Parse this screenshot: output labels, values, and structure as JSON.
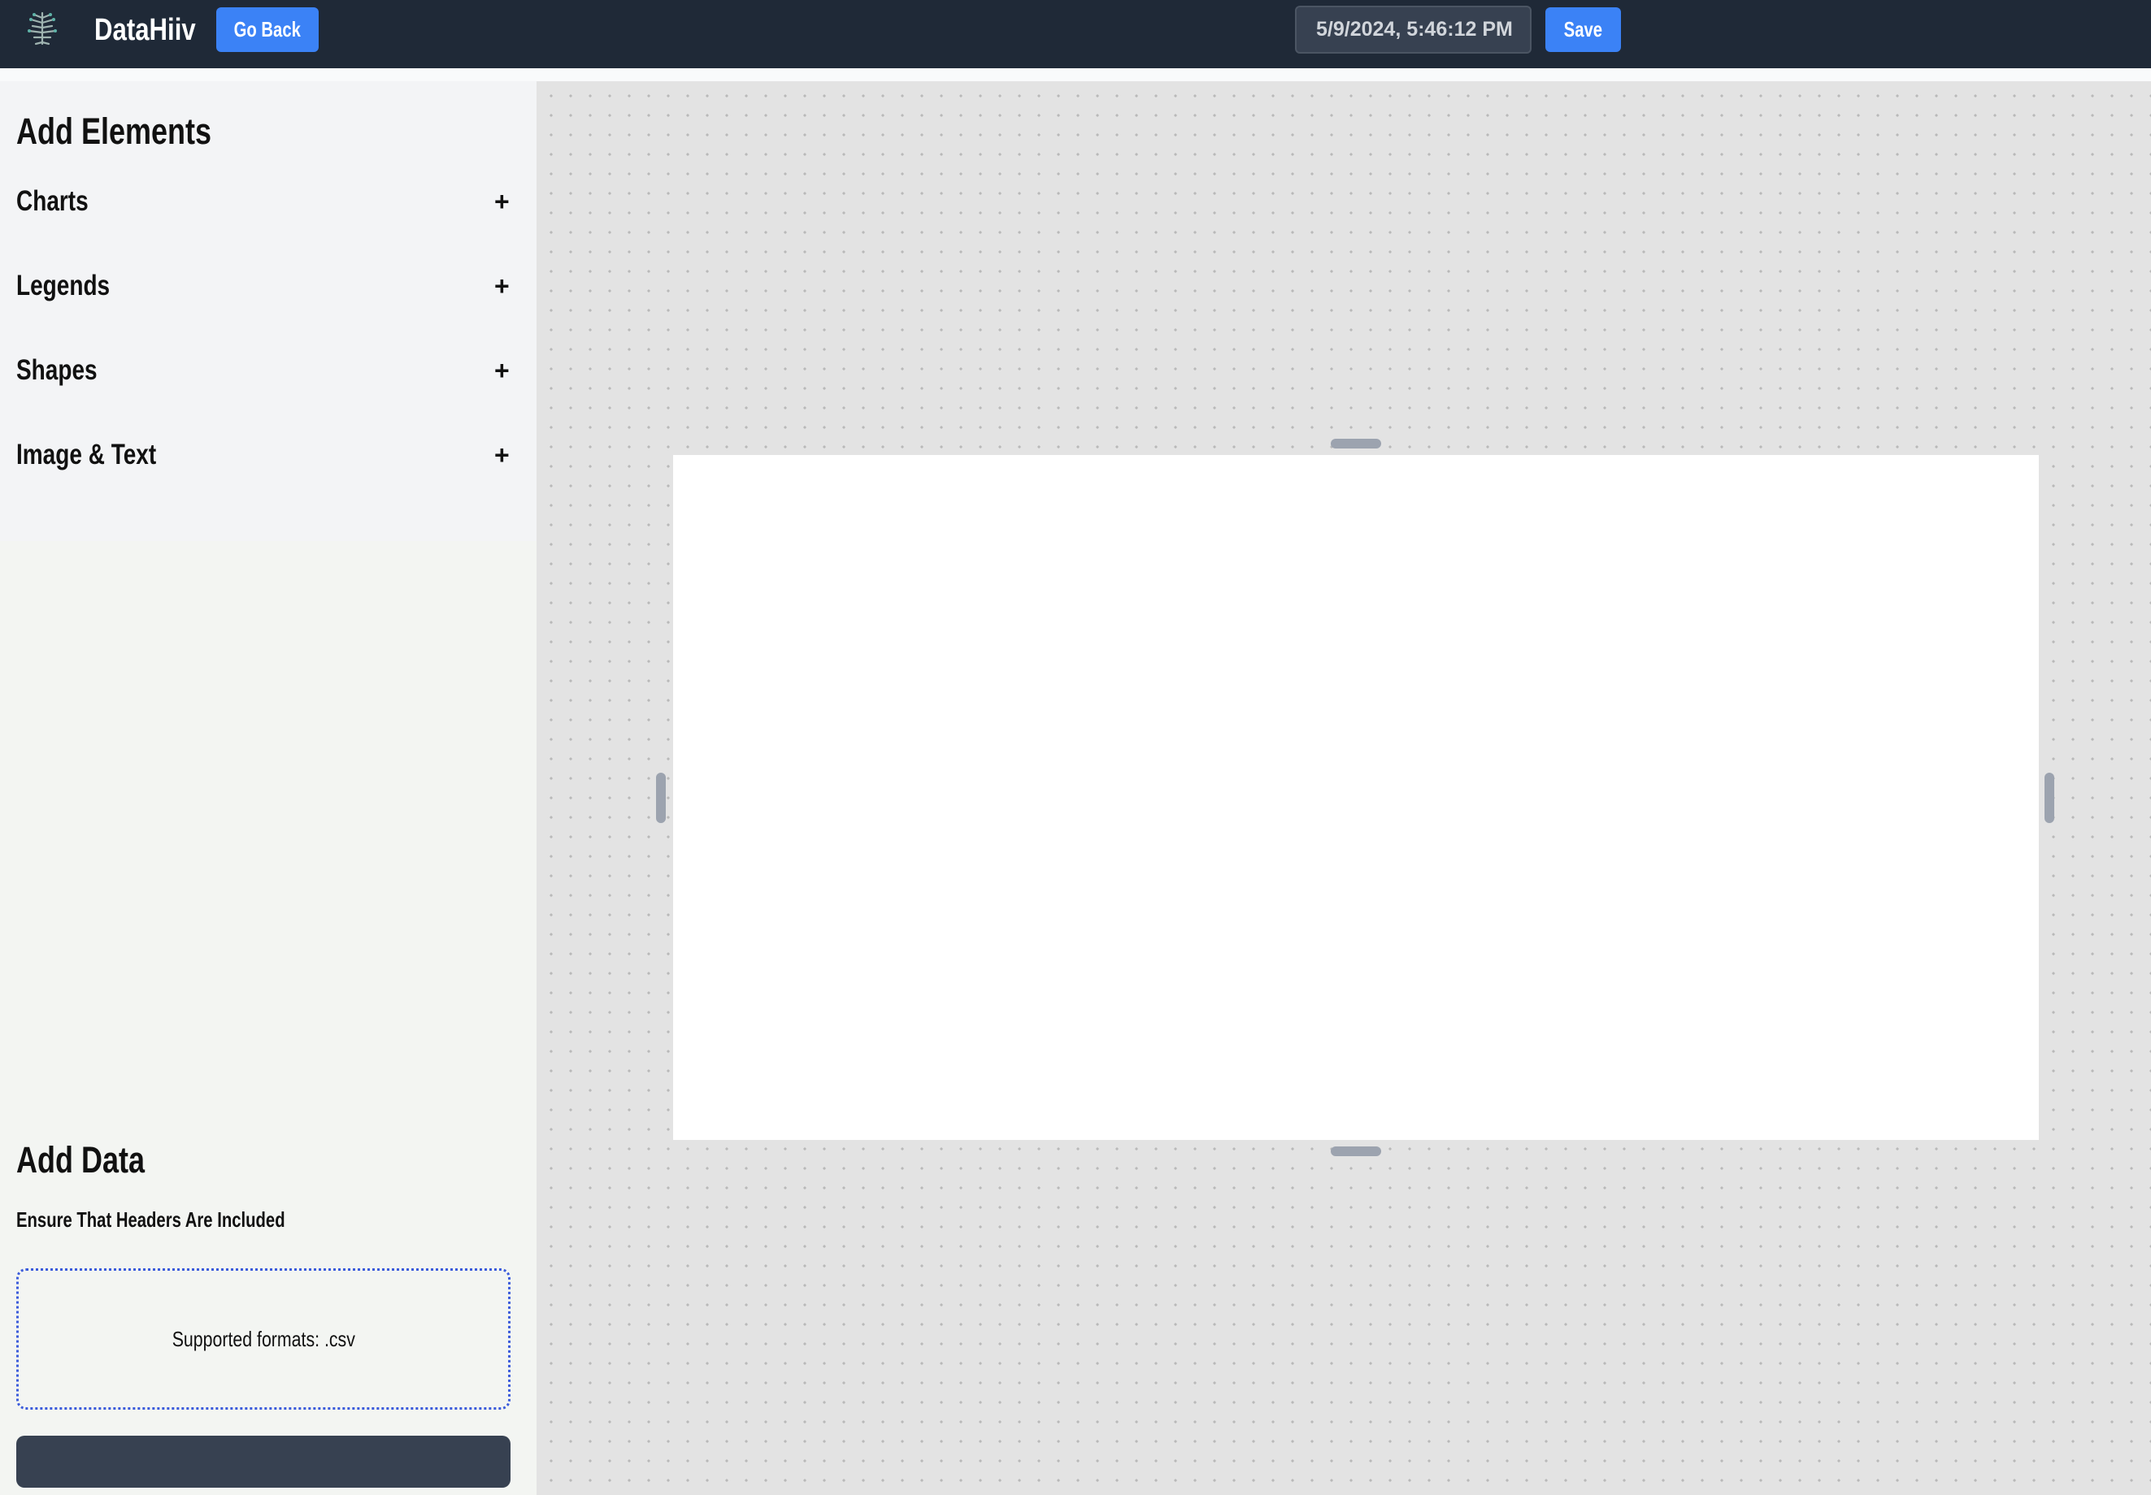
{
  "header": {
    "logo_icon": "brain-tree-icon",
    "app_title": "DataHiiv",
    "go_back_label": "Go Back",
    "timestamp_value": "5/9/2024, 5:46:12 PM",
    "save_label": "Save"
  },
  "sidebar": {
    "elements_heading": "Add Elements",
    "sections": [
      {
        "label": "Charts",
        "toggle": "+"
      },
      {
        "label": "Legends",
        "toggle": "+"
      },
      {
        "label": "Shapes",
        "toggle": "+"
      },
      {
        "label": "Image & Text",
        "toggle": "+"
      }
    ],
    "data_heading": "Add Data",
    "data_hint": "Ensure That Headers Are Included",
    "dropzone_text": "Supported formats: .csv"
  },
  "colors": {
    "topbar": "#1f2937",
    "accent": "#3b82f6",
    "dropzone_border": "#3b5bdb",
    "canvas_background": "#e3e3e3"
  }
}
